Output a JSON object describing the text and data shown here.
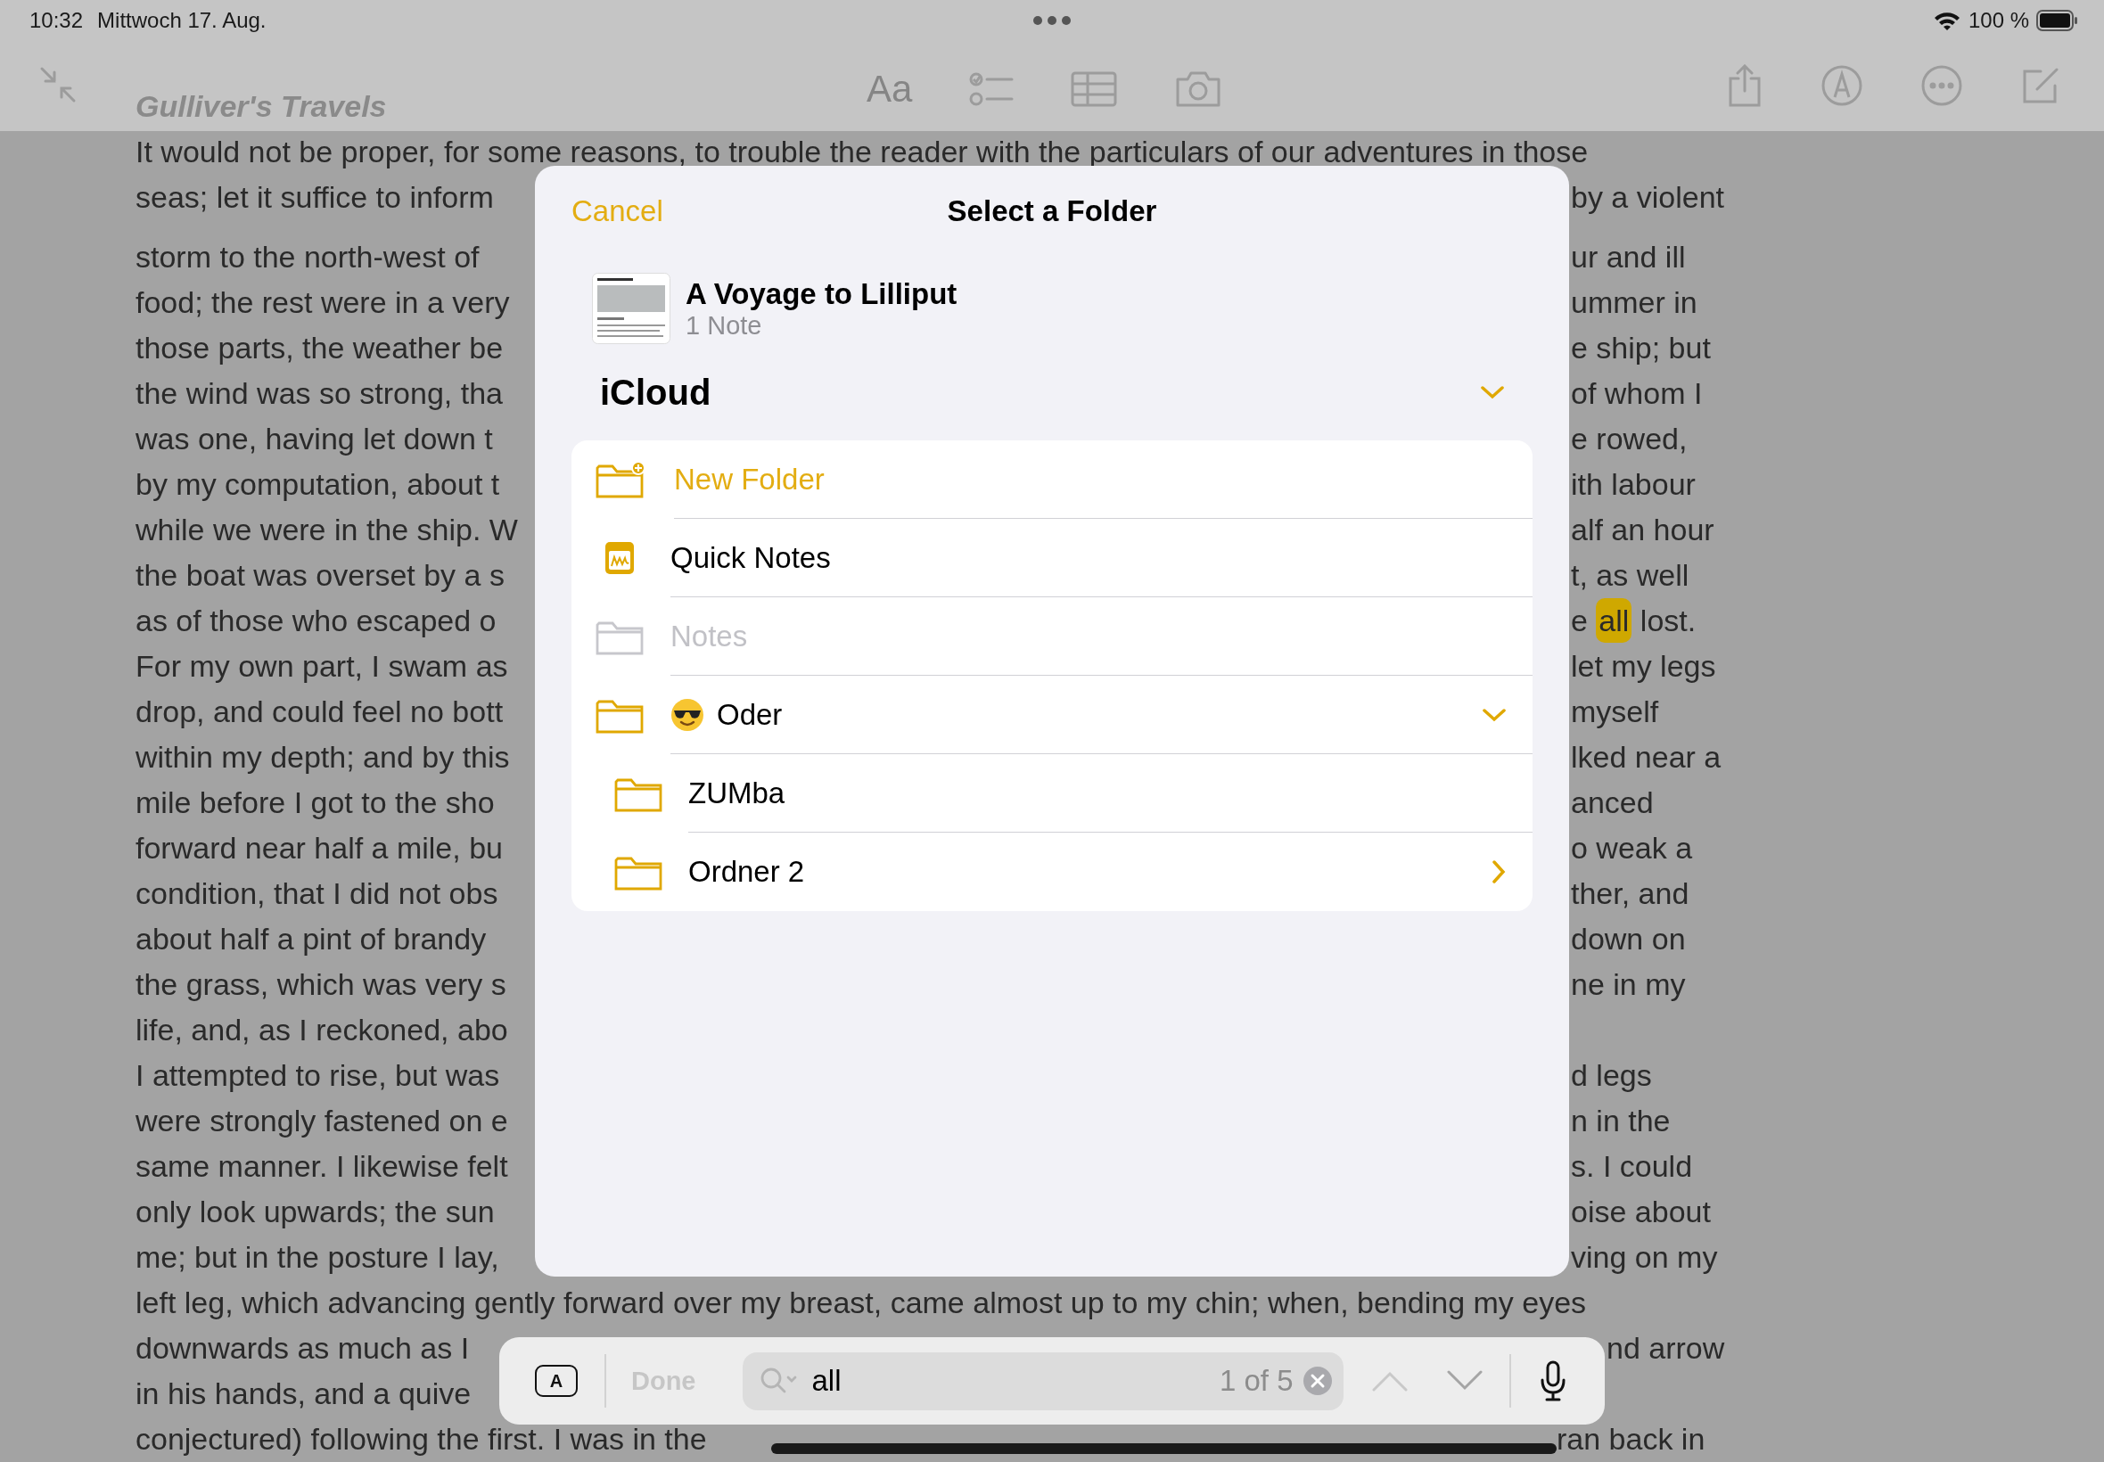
{
  "status_bar": {
    "time": "10:32",
    "date": "Mittwoch 17. Aug.",
    "battery": "100 %"
  },
  "toolbar": {
    "format_label": "Aa"
  },
  "document": {
    "title": "Gulliver's Travels",
    "paragraphs": [
      {
        "lines": [
          {
            "kind": "full",
            "text": "It would not be proper, for some reasons, to trouble the reader with the particulars of our adventures in those"
          },
          {
            "kind": "split",
            "left": "seas; let it suffice to inform",
            "right": "by a violent"
          }
        ]
      },
      {
        "lines": [
          {
            "kind": "split",
            "left": "storm to the north-west of",
            "right": "ur and ill"
          },
          {
            "kind": "split",
            "left": "food; the rest were in a very",
            "right": "ummer in"
          },
          {
            "kind": "split",
            "left": "those parts, the weather be",
            "right": "e ship; but"
          },
          {
            "kind": "split",
            "left": "the wind was so strong, tha",
            "right": "of whom I"
          },
          {
            "kind": "split",
            "left": "was one, having let down t",
            "right": "e rowed,"
          },
          {
            "kind": "split",
            "left": "by my computation, about t",
            "right": "ith labour"
          },
          {
            "kind": "split",
            "left": "while we were in the ship. W",
            "right": "alf an hour"
          },
          {
            "kind": "split",
            "left": "the boat was overset by a s",
            "right": "t, as well"
          },
          {
            "kind": "split",
            "left": "as of those who escaped o",
            "right": [
              {
                "text": "e ",
                "match": false
              },
              {
                "text": "all",
                "match": true,
                "current": true
              },
              {
                "text": " lost.",
                "match": false
              }
            ]
          },
          {
            "kind": "split",
            "left": "For my own part, I swam as",
            "right": "let my legs"
          },
          {
            "kind": "split",
            "left": "drop, and could feel no bott",
            "right": "myself"
          },
          {
            "kind": "split",
            "left": "within my depth; and by this",
            "right": "lked near a"
          },
          {
            "kind": "split",
            "left": "mile before I got to the sho",
            "right": "anced"
          },
          {
            "kind": "split",
            "left": "forward near half a mile, bu",
            "right": "o weak a"
          },
          {
            "kind": "split",
            "left": "condition, that I did not obs",
            "right": "ther, and"
          },
          {
            "kind": "split",
            "left": "about half a pint of brandy",
            "right": "down on"
          },
          {
            "kind": "split",
            "left": "the grass, which was very s",
            "right": "ne in my"
          },
          {
            "kind": "split",
            "left": "life, and, as I reckoned, abo"
          },
          {
            "kind": "split",
            "left": "I attempted to rise, but was",
            "right": "d legs"
          },
          {
            "kind": "split",
            "left": "were strongly fastened on e",
            "right": "n in the"
          },
          {
            "kind": "split",
            "left": "same manner. I likewise felt",
            "right": "s. I could"
          },
          {
            "kind": "split",
            "left": "only look upwards; the sun",
            "right": "oise about"
          },
          {
            "kind": "split",
            "left": "me; but in the posture I lay,",
            "right": "ving on my"
          },
          {
            "kind": "full",
            "text": "left leg, which advancing gently forward over my breast, came almost up to my chin; when, bending my eyes"
          },
          {
            "kind": "split_bar",
            "left": "downwards as much as I",
            "right": "nd arrow"
          },
          {
            "kind": "split_bar",
            "left": "in his hands, and a quive"
          },
          {
            "kind": "split_home",
            "left": "conjectured) following the first. I was in the",
            "right": "ran back in"
          }
        ]
      }
    ]
  },
  "folder_picker": {
    "cancel": "Cancel",
    "title": "Select a Folder",
    "note": {
      "title": "A Voyage to Lilliput",
      "count": "1 Note"
    },
    "account": {
      "name": "iCloud",
      "expanded": true
    },
    "folders": [
      {
        "kind": "new",
        "label": "New Folder"
      },
      {
        "kind": "quick",
        "label": "Quick Notes"
      },
      {
        "kind": "folder",
        "label": "Notes",
        "disabled": true,
        "emoji_icon": false,
        "expandable": false
      },
      {
        "kind": "folder",
        "label": "Oder",
        "disabled": false,
        "emoji_icon": true,
        "expandable": true,
        "expanded": true,
        "children": [
          {
            "kind": "folder",
            "label": "ZUMba",
            "disabled": false,
            "emoji_icon": false,
            "expandable": false
          },
          {
            "kind": "folder",
            "label": "Ordner 2",
            "disabled": false,
            "emoji_icon": false,
            "expandable": true,
            "expanded": false
          }
        ]
      }
    ]
  },
  "find_bar": {
    "format_key": "A",
    "done": "Done",
    "done_disabled": true,
    "query": "all",
    "count": "1 of 5",
    "previous_disabled": true,
    "next_disabled": false
  }
}
